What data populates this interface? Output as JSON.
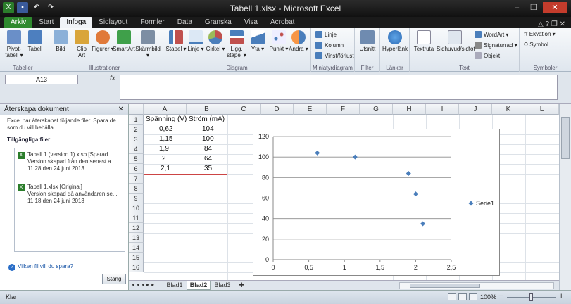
{
  "window": {
    "title": "Tabell 1.xlsx - Microsoft Excel",
    "minimize": "–",
    "restore": "❐",
    "close": "✕"
  },
  "tabs": [
    "Arkiv",
    "Start",
    "Infoga",
    "Sidlayout",
    "Formler",
    "Data",
    "Granska",
    "Visa",
    "Acrobat"
  ],
  "tabs_right": "△ ? ❐ ✕",
  "ribbon": {
    "groups": {
      "tabeller": "Tabeller",
      "illustrationer": "Illustrationer",
      "diagram": "Diagram",
      "miniatyr": "Miniatyrdiagram",
      "filter": "Filter",
      "lankar": "Länkar",
      "text": "Text",
      "symboler": "Symboler"
    },
    "buttons": {
      "pivot": "Pivot-\ntabell ▾",
      "tabell": "Tabell",
      "bild": "Bild",
      "clipart": "Clip\nArt",
      "figurer": "Figurer ▾",
      "smartart": "SmartArt",
      "skarmbild": "Skärmbild ▾",
      "stapel": "Stapel ▾",
      "linje": "Linje ▾",
      "cirkel": "Cirkel ▾",
      "liggstapel": "Ligg.\nstapel ▾",
      "yta": "Yta ▾",
      "punkt": "Punkt ▾",
      "andra": "Andra ▾",
      "spark_linje": "Linje",
      "spark_kolumn": "Kolumn",
      "spark_vinst": "Vinst/förlust",
      "utsnitt": "Utsnitt",
      "hyperlank": "Hyperlänk",
      "textruta": "Textruta",
      "sidhuvud": "Sidhuvud/sidfot",
      "wordart": "WordArt ▾",
      "signatur": "Signaturrad ▾",
      "objekt": "Objekt",
      "ekvation": "π Ekvation ▾",
      "symbol": "Ω Symbol"
    }
  },
  "formula_bar": {
    "name_box": "A13",
    "fx": "fx",
    "value": ""
  },
  "recovery_panel": {
    "title": "Återskapa dokument",
    "close": "✕",
    "description": "Excel har återskapat följande filer. Spara de som du vill behålla.",
    "available_label": "Tillgängliga filer",
    "files": [
      {
        "name": "Tabell 1 (version 1).xlsb  [Sparad...",
        "detail": "Version skapad från den senast a...",
        "time": "11:28 den 24 juni 2013"
      },
      {
        "name": "Tabell 1.xlsx  [Original]",
        "detail": "Version skapad då användaren se...",
        "time": "11:18 den 24 juni 2013"
      }
    ],
    "help": "Vilken fil vill du spara?",
    "close_button": "Stäng"
  },
  "sheet": {
    "columns": [
      "A",
      "B",
      "C",
      "D",
      "E",
      "F",
      "G",
      "H",
      "I",
      "J",
      "K",
      "L"
    ],
    "rows": [
      "1",
      "2",
      "3",
      "4",
      "5",
      "6",
      "7",
      "8",
      "9",
      "10",
      "11",
      "12",
      "13",
      "14",
      "15",
      "16"
    ],
    "headers": {
      "a1": "Spänning (V)",
      "b1": "Ström (mA)"
    },
    "data": [
      {
        "a": "0,62",
        "b": "104"
      },
      {
        "a": "1,15",
        "b": "100"
      },
      {
        "a": "1,9",
        "b": "84"
      },
      {
        "a": "2",
        "b": "64"
      },
      {
        "a": "2,1",
        "b": "35"
      }
    ]
  },
  "chart_data": {
    "type": "scatter",
    "series": [
      {
        "name": "Serie1",
        "x": [
          0.62,
          1.15,
          1.9,
          2,
          2.1
        ],
        "y": [
          104,
          100,
          84,
          64,
          35
        ],
        "color": "#4a7ebb"
      }
    ],
    "xlim": [
      0,
      2.5
    ],
    "ylim": [
      0,
      120
    ],
    "x_ticks": [
      "0",
      "0,5",
      "1",
      "1,5",
      "2",
      "2,5"
    ],
    "y_ticks": [
      "0",
      "20",
      "40",
      "60",
      "80",
      "100",
      "120"
    ],
    "grid": true,
    "legend": "right"
  },
  "sheet_tabs": [
    "Blad1",
    "Blad2",
    "Blad3"
  ],
  "active_sheet": "Blad2",
  "status": {
    "ready": "Klar",
    "zoom": "100%",
    "minus": "−",
    "plus": "+"
  }
}
